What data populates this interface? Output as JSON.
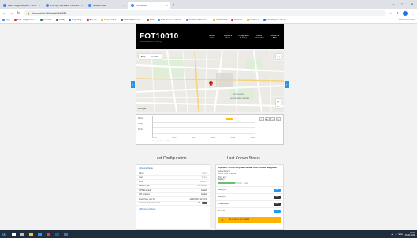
{
  "browser": {
    "tabs": [
      {
        "label": "Mail - fot@fotsignup - Schuster",
        "active": false
      },
      {
        "label": "FOTfly - VMS and VDM testing",
        "active": false
      },
      {
        "label": "GREENTAB",
        "active": false
      },
      {
        "label": "FOT10010",
        "active": true
      }
    ],
    "new_tab": "+",
    "url": "fotportal.fot.fot/fotunit/fot10010",
    "bookmarks": [
      {
        "label": "Apps",
        "color": "#4285f4"
      },
      {
        "label": "FOT - fot@fotsignu...",
        "color": "#d93025"
      },
      {
        "label": "FotpaNG",
        "color": "#188038"
      },
      {
        "label": "FOTfly",
        "color": "#188038"
      },
      {
        "label": "Login Page",
        "color": "#1a73e8"
      },
      {
        "label": "Browser",
        "color": "#d93025"
      },
      {
        "label": "Fotportal TLF",
        "color": "#f9ab00"
      },
      {
        "label": "FOT/FOT32 Gatew...",
        "color": "#5f6368"
      },
      {
        "label": "FOT",
        "color": "#d93025"
      },
      {
        "label": "FOT Ringtone Checker",
        "color": "#4285f4"
      },
      {
        "label": "Dashboard Munch c...",
        "color": "#4285f4"
      },
      {
        "label": "HOVM 0000",
        "color": "#f9ab00"
      },
      {
        "label": "Products",
        "color": "#d93025"
      },
      {
        "label": "Dashboard",
        "color": "#f9ab00"
      },
      {
        "label": "FOT Ringtone Clients",
        "color": "#1a73e8"
      }
    ],
    "other_bookmarks": "Other bookmarks"
  },
  "header": {
    "title": "FOT10010",
    "subtitle": "Unified Wireless Gateway",
    "nav": [
      "Current Status",
      "Reports & Alerts",
      "Configuration & Setup",
      "Device Information",
      "Account & Billing"
    ]
  },
  "map": {
    "tabs": [
      "Map",
      "Satellite"
    ],
    "active_tab": "Map",
    "labels": [
      "NORTH END",
      "SOUTH ENDS CENTER"
    ],
    "logo": "Google"
  },
  "timeline": {
    "row_labels": [
      "Report",
      "Temp",
      "Tamp"
    ],
    "ticks": [
      "12:00",
      "14:00",
      "16:00",
      "18:00",
      "20:00",
      "22:00"
    ],
    "date": "Friday 30 August 2019",
    "controls": [
      "◄",
      "►",
      "−",
      "+"
    ]
  },
  "config": {
    "title": "Last Configuration",
    "group1": "• Device Mode",
    "rows": [
      {
        "label": "Name",
        "value": "Name",
        "dark": false
      },
      {
        "label": "Alert",
        "value": "Phone",
        "dark": false
      },
      {
        "label": "Limit",
        "value": "No Limit",
        "dark": false
      },
      {
        "label": "Report Type",
        "value": "Individually",
        "dark": false
      },
      {
        "label": "GPS Enabled",
        "value": "Enable",
        "dark": true
      },
      {
        "label": "GM Enabled",
        "value": "Enable",
        "dark": true
      },
      {
        "label": "Modal Dev. GS Vis",
        "value": "11:00:2019 11:03:30",
        "dark": true
      },
      {
        "label": "Location Report Interval",
        "value": "60",
        "dark": true
      }
    ],
    "group2": "• Phone numbers"
  },
  "status": {
    "title": "Last Known Status",
    "device_title": "Operator: Cronin Bergnaum Mobile 1000 (Unified) Bergnaum",
    "last_report_label": "Latest Report:",
    "last_report_value": "30-08-2019 11:59:35",
    "time_ago_label": "Time ago:",
    "battery_label": "Battery:",
    "battery_fraction": 0.7,
    "battery_text": "70%",
    "switches": [
      {
        "label": "Relays 1",
        "on": true,
        "text": "ON"
      },
      {
        "label": "Relays 2",
        "on": false,
        "text": "OFF"
      },
      {
        "label": "Transmitters",
        "on": false,
        "text": "OFF"
      },
      {
        "label": "Security",
        "on": true,
        "text": "ON"
      }
    ],
    "warning_icon": "⚠",
    "warning_text": "The device is not installed"
  },
  "taskbar": {
    "time": "14:02",
    "date": "30-08-2019",
    "lang": "ENG",
    "icons": [
      {
        "name": "search",
        "color": "#ffffff"
      },
      {
        "name": "task-view",
        "color": "#c0c0c0"
      },
      {
        "name": "file-explorer",
        "color": "#f5c542"
      },
      {
        "name": "mail",
        "color": "#3f8fe0"
      },
      {
        "name": "chrome",
        "color": "#ea4335"
      },
      {
        "name": "word",
        "color": "#2b5797"
      },
      {
        "name": "teams",
        "color": "#6264a7"
      }
    ]
  }
}
